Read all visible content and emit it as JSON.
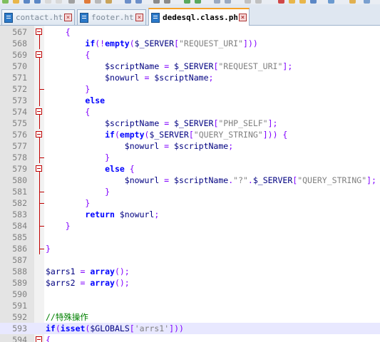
{
  "tabs": [
    {
      "label": "contact.htm",
      "active": false
    },
    {
      "label": "footer.htm",
      "active": false
    },
    {
      "label": "dedesql.class.php",
      "active": true
    }
  ],
  "editor": {
    "current_line": "593",
    "lines": [
      {
        "n": "567",
        "fold": "box",
        "indent": "    ",
        "t": [
          [
            "op",
            "{"
          ]
        ]
      },
      {
        "n": "568",
        "fold": "line",
        "indent": "        ",
        "t": [
          [
            "kw",
            "if"
          ],
          [
            "op",
            "(!"
          ],
          [
            "kw",
            "empty"
          ],
          [
            "op",
            "("
          ],
          [
            "var",
            "$_SERVER"
          ],
          [
            "op",
            "["
          ],
          [
            "str",
            "\"REQUEST_URI\""
          ],
          [
            "op",
            "]))"
          ]
        ]
      },
      {
        "n": "569",
        "fold": "box",
        "indent": "        ",
        "t": [
          [
            "op",
            "{"
          ]
        ]
      },
      {
        "n": "570",
        "fold": "line",
        "indent": "            ",
        "t": [
          [
            "var",
            "$scriptName"
          ],
          [
            "op",
            " = "
          ],
          [
            "var",
            "$_SERVER"
          ],
          [
            "op",
            "["
          ],
          [
            "str",
            "\"REQUEST_URI\""
          ],
          [
            "op",
            "];"
          ]
        ]
      },
      {
        "n": "571",
        "fold": "line",
        "indent": "            ",
        "t": [
          [
            "var",
            "$nowurl"
          ],
          [
            "op",
            " = "
          ],
          [
            "var",
            "$scriptName"
          ],
          [
            "op",
            ";"
          ]
        ]
      },
      {
        "n": "572",
        "fold": "end",
        "indent": "        ",
        "t": [
          [
            "op",
            "}"
          ]
        ]
      },
      {
        "n": "573",
        "fold": "line",
        "indent": "        ",
        "t": [
          [
            "kw",
            "else"
          ]
        ]
      },
      {
        "n": "574",
        "fold": "box",
        "indent": "        ",
        "t": [
          [
            "op",
            "{"
          ]
        ]
      },
      {
        "n": "575",
        "fold": "line",
        "indent": "            ",
        "t": [
          [
            "var",
            "$scriptName"
          ],
          [
            "op",
            " = "
          ],
          [
            "var",
            "$_SERVER"
          ],
          [
            "op",
            "["
          ],
          [
            "str",
            "\"PHP_SELF\""
          ],
          [
            "op",
            "];"
          ]
        ]
      },
      {
        "n": "576",
        "fold": "box",
        "indent": "            ",
        "t": [
          [
            "kw",
            "if"
          ],
          [
            "op",
            "("
          ],
          [
            "kw",
            "empty"
          ],
          [
            "op",
            "("
          ],
          [
            "var",
            "$_SERVER"
          ],
          [
            "op",
            "["
          ],
          [
            "str",
            "\"QUERY_STRING\""
          ],
          [
            "op",
            "])) {"
          ]
        ]
      },
      {
        "n": "577",
        "fold": "line",
        "indent": "                ",
        "t": [
          [
            "var",
            "$nowurl"
          ],
          [
            "op",
            " = "
          ],
          [
            "var",
            "$scriptName"
          ],
          [
            "op",
            ";"
          ]
        ]
      },
      {
        "n": "578",
        "fold": "end",
        "indent": "            ",
        "t": [
          [
            "op",
            "}"
          ]
        ]
      },
      {
        "n": "579",
        "fold": "box",
        "indent": "            ",
        "t": [
          [
            "kw",
            "else"
          ],
          [
            "op",
            " {"
          ]
        ]
      },
      {
        "n": "580",
        "fold": "line",
        "indent": "                ",
        "t": [
          [
            "var",
            "$nowurl"
          ],
          [
            "op",
            " = "
          ],
          [
            "var",
            "$scriptName"
          ],
          [
            "op",
            "."
          ],
          [
            "str",
            "\"?\""
          ],
          [
            "op",
            "."
          ],
          [
            "var",
            "$_SERVER"
          ],
          [
            "op",
            "["
          ],
          [
            "str",
            "\"QUERY_STRING\""
          ],
          [
            "op",
            "];"
          ]
        ]
      },
      {
        "n": "581",
        "fold": "end",
        "indent": "            ",
        "t": [
          [
            "op",
            "}"
          ]
        ]
      },
      {
        "n": "582",
        "fold": "end",
        "indent": "        ",
        "t": [
          [
            "op",
            "}"
          ]
        ]
      },
      {
        "n": "583",
        "fold": "line",
        "indent": "        ",
        "t": [
          [
            "kw",
            "return"
          ],
          [
            "op",
            " "
          ],
          [
            "var",
            "$nowurl"
          ],
          [
            "op",
            ";"
          ]
        ]
      },
      {
        "n": "584",
        "fold": "end",
        "indent": "    ",
        "t": [
          [
            "op",
            "}"
          ]
        ]
      },
      {
        "n": "585",
        "fold": "line",
        "indent": "",
        "t": []
      },
      {
        "n": "586",
        "fold": "end",
        "indent": "",
        "t": [
          [
            "op",
            "}"
          ]
        ]
      },
      {
        "n": "587",
        "fold": "none",
        "indent": "",
        "t": []
      },
      {
        "n": "588",
        "fold": "none",
        "indent": "",
        "t": [
          [
            "var",
            "$arrs1"
          ],
          [
            "op",
            " = "
          ],
          [
            "kw",
            "array"
          ],
          [
            "op",
            "();"
          ]
        ]
      },
      {
        "n": "589",
        "fold": "none",
        "indent": "",
        "t": [
          [
            "var",
            "$arrs2"
          ],
          [
            "op",
            " = "
          ],
          [
            "kw",
            "array"
          ],
          [
            "op",
            "();"
          ]
        ]
      },
      {
        "n": "590",
        "fold": "none",
        "indent": "",
        "t": []
      },
      {
        "n": "591",
        "fold": "none",
        "indent": "",
        "t": []
      },
      {
        "n": "592",
        "fold": "none",
        "indent": "",
        "t": [
          [
            "cm",
            "//特殊操作"
          ]
        ]
      },
      {
        "n": "593",
        "fold": "none",
        "indent": "",
        "t": [
          [
            "kw",
            "if"
          ],
          [
            "op",
            "("
          ],
          [
            "kw",
            "isset"
          ],
          [
            "op",
            "("
          ],
          [
            "var",
            "$GLOBALS"
          ],
          [
            "op",
            "["
          ],
          [
            "str",
            "'arrs1'"
          ],
          [
            "op",
            "]))"
          ]
        ]
      },
      {
        "n": "594",
        "fold": "box",
        "indent": "",
        "t": [
          [
            "op",
            "{"
          ]
        ]
      }
    ]
  },
  "colors": {
    "keyword": "#0000ff",
    "variable": "#000080",
    "string": "#808080",
    "operator": "#8000ff",
    "comment": "#008000",
    "fold_marker": "#c00000"
  }
}
